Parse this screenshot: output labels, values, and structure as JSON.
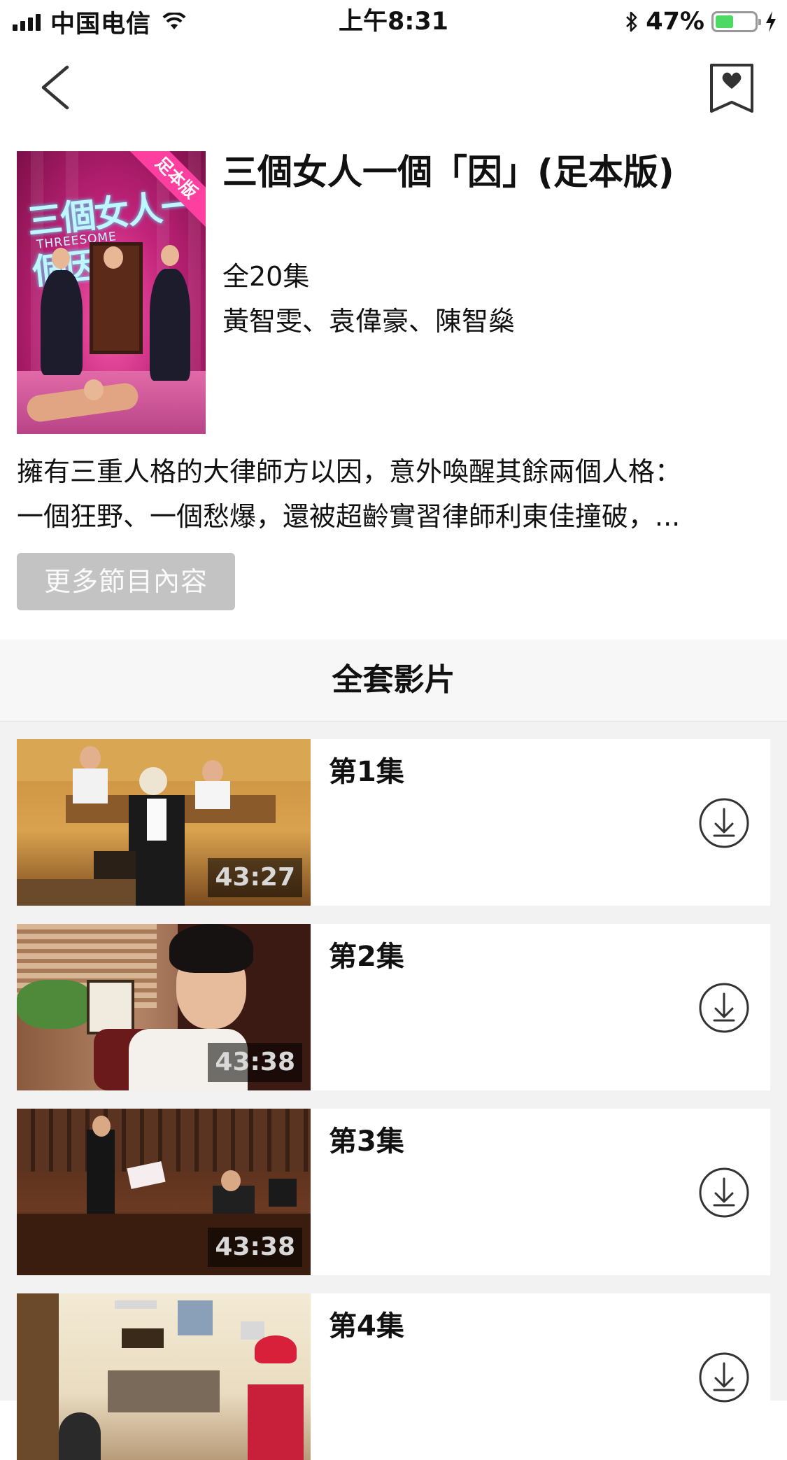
{
  "status_bar": {
    "carrier": "中国电信",
    "time": "上午8:31",
    "battery_percent": "47%",
    "battery_level": 0.47,
    "battery_color": "#4cd964"
  },
  "nav": {
    "back_icon": "chevron-left-icon",
    "bookmark_icon": "bookmark-heart-icon"
  },
  "show": {
    "title": "三個女人一個「因」(足本版)",
    "poster_ribbon": "足本版",
    "poster_title": "三個女人一個因",
    "poster_subtitle": "THREESOME",
    "episodes_count": "全20集",
    "cast": "黃智雯、袁偉豪、陳智燊",
    "synopsis_lines": [
      "擁有三重人格的大律師方以因，意外喚醒其餘兩個人格：",
      "一個狂野、一個愁爆，還被超齡實習律師利東佳撞破，..."
    ],
    "more_button": "更多節目內容"
  },
  "section": {
    "title": "全套影片"
  },
  "episodes": [
    {
      "label": "第1集",
      "duration": "43:27"
    },
    {
      "label": "第2集",
      "duration": "43:38"
    },
    {
      "label": "第3集",
      "duration": "43:38"
    },
    {
      "label": "第4集",
      "duration": ""
    }
  ],
  "colors": {
    "accent_ribbon": "#ff3fa0",
    "more_button_bg": "#c3c3c3",
    "list_bg": "#f2f2f2"
  }
}
